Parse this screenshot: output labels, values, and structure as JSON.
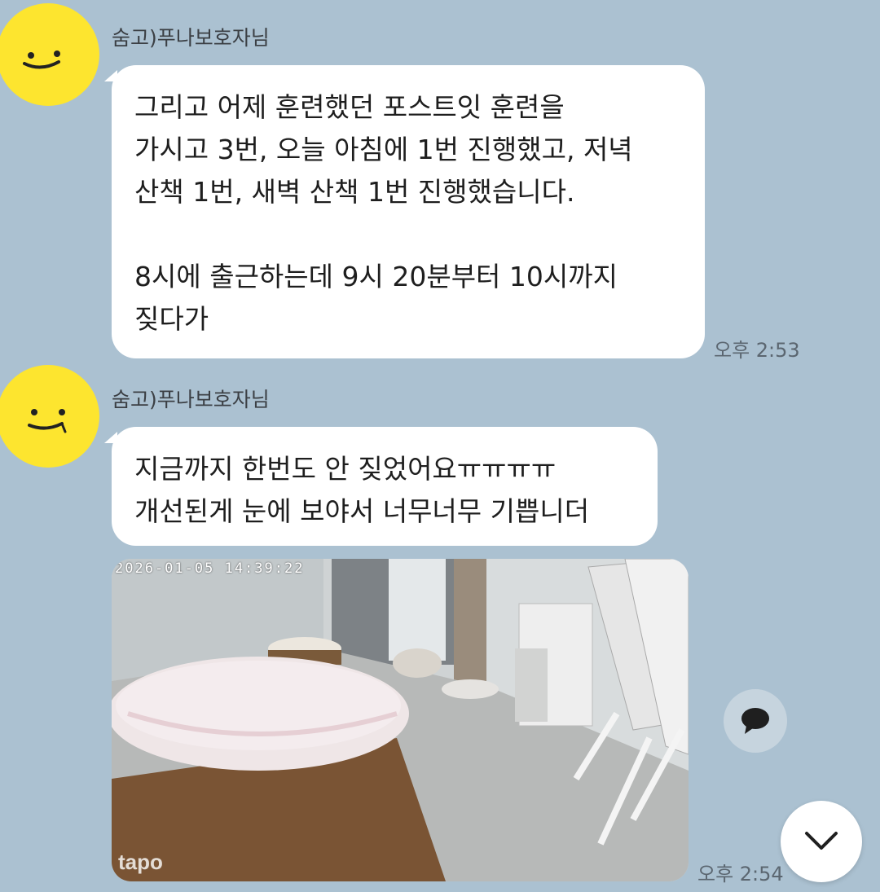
{
  "messages": [
    {
      "sender": "숨고)푸나보호자님",
      "lines": [
        "그리고 어제 훈련했던 포스트잇 훈련을",
        "가시고 3번, 오늘 아침에 1번 진행했고, 저녁",
        "산책 1번, 새벽 산책 1번 진행했습니다.",
        "",
        "8시에 출근하는데 9시 20분부터 10시까지",
        "짖다가"
      ],
      "time": "오후 2:53"
    },
    {
      "sender": "숨고)푸나보호자님",
      "lines": [
        "지금까지 한번도 안 짖었어요ㅠㅠㅠㅠ",
        "개선된게 눈에 보야서 너무너무 기쁩니더"
      ]
    }
  ],
  "photo": {
    "timestamp": "2026-01-05 14:39:22",
    "watermark": "tapo",
    "time": "오후 2:54"
  },
  "icons": {
    "avatar": "smiley-face-icon",
    "comment": "speech-bubble-icon",
    "scroll_down": "chevron-down-icon"
  },
  "colors": {
    "background": "#abc1d1",
    "bubble": "#ffffff",
    "avatar": "#fde52f"
  }
}
